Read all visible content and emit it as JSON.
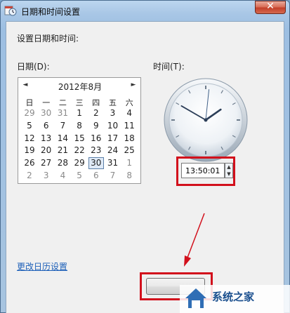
{
  "window": {
    "title": "日期和时间设置",
    "close_glyph": "✕"
  },
  "header": {
    "text": "设置日期和时间:"
  },
  "date_label": "日期(D):",
  "time_label": "时间(T):",
  "calendar": {
    "title": "2012年8月",
    "prev_glyph": "◄",
    "next_glyph": "►",
    "weekdays": [
      "日",
      "一",
      "二",
      "三",
      "四",
      "五",
      "六"
    ],
    "weeks": [
      [
        "29",
        "30",
        "31",
        "1",
        "2",
        "3",
        "4"
      ],
      [
        "5",
        "6",
        "7",
        "8",
        "9",
        "10",
        "11"
      ],
      [
        "12",
        "13",
        "14",
        "15",
        "16",
        "17",
        "18"
      ],
      [
        "19",
        "20",
        "21",
        "22",
        "23",
        "24",
        "25"
      ],
      [
        "26",
        "27",
        "28",
        "29",
        "30",
        "31",
        "1"
      ],
      [
        "2",
        "3",
        "4",
        "5",
        "6",
        "7",
        "8"
      ]
    ],
    "selected_day": "30"
  },
  "clock": {
    "hours": 13,
    "minutes": 50,
    "seconds": 1
  },
  "time": {
    "value": "13:50:01"
  },
  "link_text": "更改日历设置",
  "watermark": {
    "text": "系统之家"
  },
  "colors": {
    "highlight": "#d2101c",
    "link": "#1c5fb8",
    "selected_day_border": "#5b7fa8"
  }
}
